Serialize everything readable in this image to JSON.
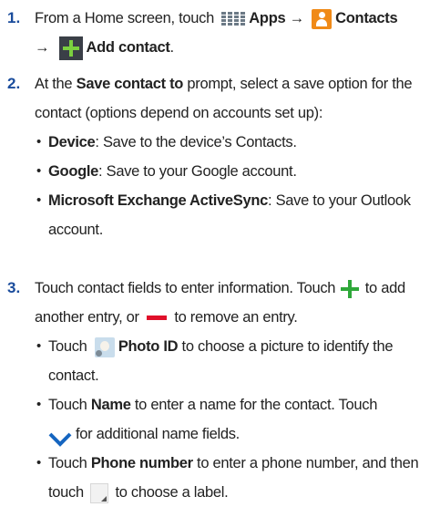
{
  "steps": [
    {
      "number": "1.",
      "t1": "From a Home screen, touch",
      "apps": "Apps",
      "arrow1": "→",
      "contacts": "Contacts",
      "arrow2": "→",
      "add_contact": "Add contact",
      "t_end": "."
    },
    {
      "number": "2.",
      "t1": "At the",
      "save_to": "Save contact to",
      "t2": "prompt, select a save option for the contact (options depend on accounts set up):",
      "options": [
        {
          "name": "Device",
          "desc": ": Save to the device’s Contacts."
        },
        {
          "name": "Google",
          "desc": ": Save to your Google account."
        },
        {
          "name": "Microsoft Exchange ActiveSync",
          "desc": ": Save to your Outlook account."
        }
      ]
    },
    {
      "number": "3.",
      "t1": "Touch contact fields to enter information. Touch",
      "t2": "to add another entry, or",
      "t3": "to remove an entry.",
      "bullets": [
        {
          "pre": "Touch",
          "bold": "Photo ID",
          "post": "to choose a picture to identify the contact."
        },
        {
          "pre": "Touch",
          "bold": "Name",
          "post": "to enter a name for the contact. Touch",
          "post2": "for additional name fields."
        },
        {
          "pre": "Touch",
          "bold": "Phone number",
          "post": "to enter a phone number, and then touch",
          "post2": "to choose a label."
        }
      ]
    }
  ],
  "icons": [
    "apps-grid-icon",
    "contacts-icon",
    "add-contact-icon",
    "add-entry-icon",
    "remove-entry-icon",
    "photo-id-icon",
    "chevron-down-icon",
    "label-picker-icon"
  ],
  "colors": {
    "step_number": "#1a4c9c",
    "contacts_icon": "#f08a17",
    "add_green": "#7bd03f",
    "plus_green": "#2fa83a",
    "minus_red": "#e0102a",
    "chevron_blue": "#1565c0"
  }
}
